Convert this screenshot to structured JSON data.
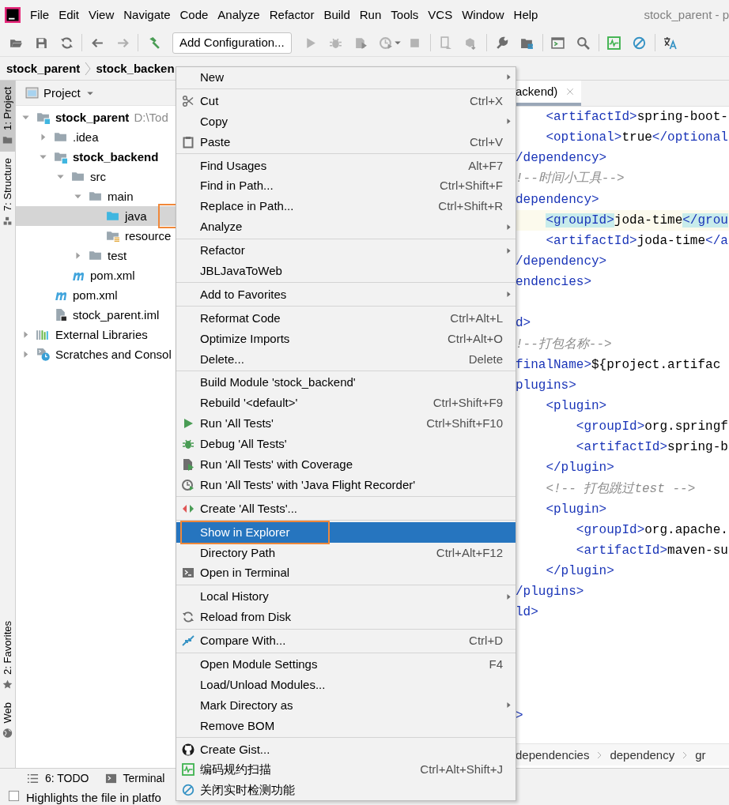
{
  "window": {
    "title": "stock_parent - p"
  },
  "menu_bar": [
    "File",
    "Edit",
    "View",
    "Navigate",
    "Code",
    "Analyze",
    "Refactor",
    "Build",
    "Run",
    "Tools",
    "VCS",
    "Window",
    "Help"
  ],
  "toolbar": {
    "run_config": "Add Configuration..."
  },
  "nav_bar": [
    "stock_parent",
    "stock_backen"
  ],
  "side_tabs_top": [
    {
      "label": "1: Project",
      "selected": true
    },
    {
      "label": "7: Structure",
      "selected": false
    }
  ],
  "side_tabs_bottom": [
    {
      "label": "2: Favorites",
      "selected": false
    },
    {
      "label": "Web",
      "selected": false
    }
  ],
  "project": {
    "title": "Project",
    "tree": [
      {
        "label": "stock_parent",
        "hint": "D:\\Tod",
        "kind": "module",
        "expanded": true,
        "selected": false,
        "outlined": false,
        "children": [
          {
            "label": ".idea",
            "kind": "folder",
            "expanded": false,
            "selected": false,
            "outlined": false
          },
          {
            "label": "stock_backend",
            "kind": "module",
            "expanded": true,
            "selected": false,
            "outlined": false,
            "children": [
              {
                "label": "src",
                "kind": "folder",
                "expanded": true,
                "selected": false,
                "outlined": false,
                "children": [
                  {
                    "label": "main",
                    "kind": "folder",
                    "expanded": true,
                    "selected": false,
                    "outlined": false,
                    "children": [
                      {
                        "label": "java",
                        "kind": "source-folder",
                        "selected": true,
                        "outlined": true
                      },
                      {
                        "label": "resource",
                        "kind": "resource-folder",
                        "selected": false,
                        "outlined": false
                      }
                    ]
                  },
                  {
                    "label": "test",
                    "kind": "folder",
                    "expanded": false,
                    "selected": false,
                    "outlined": false
                  }
                ]
              },
              {
                "label": "pom.xml",
                "kind": "maven",
                "selected": false,
                "outlined": false
              }
            ]
          },
          {
            "label": "pom.xml",
            "kind": "maven",
            "selected": false,
            "outlined": false
          },
          {
            "label": "stock_parent.iml",
            "kind": "iml",
            "selected": false,
            "outlined": false
          }
        ]
      },
      {
        "label": "External Libraries",
        "kind": "libraries",
        "expanded": false,
        "selected": false,
        "outlined": false
      },
      {
        "label": "Scratches and Consol",
        "kind": "scratches",
        "expanded": false,
        "selected": false,
        "outlined": false
      }
    ]
  },
  "editor": {
    "tab": "ackend)",
    "lines": [
      {
        "kind": "code",
        "current": false,
        "segs": [
          {
            "text": "    <artifactId>",
            "kind": "tag"
          },
          {
            "text": "spring-boot-",
            "kind": "text"
          }
        ]
      },
      {
        "kind": "code",
        "current": false,
        "segs": [
          {
            "text": "    <optional>",
            "kind": "tag"
          },
          {
            "text": "true",
            "kind": "text"
          },
          {
            "text": "</optional",
            "kind": "tag"
          }
        ]
      },
      {
        "kind": "code",
        "current": false,
        "segs": [
          {
            "text": "/dependency>",
            "kind": "tag"
          }
        ]
      },
      {
        "kind": "code",
        "current": false,
        "segs": [
          {
            "text": "!--时间小工具-->",
            "kind": "comment"
          }
        ]
      },
      {
        "kind": "code",
        "current": false,
        "segs": [
          {
            "text": "dependency>",
            "kind": "tag"
          }
        ]
      },
      {
        "kind": "code",
        "current": true,
        "segs": [
          {
            "text": "    <groupId>",
            "kind": "match"
          },
          {
            "text": "joda-time",
            "kind": "text"
          },
          {
            "text": "</grou",
            "kind": "match"
          }
        ]
      },
      {
        "kind": "code",
        "current": false,
        "segs": [
          {
            "text": "    <artifactId>",
            "kind": "tag"
          },
          {
            "text": "joda-time",
            "kind": "text"
          },
          {
            "text": "</a",
            "kind": "tag"
          }
        ]
      },
      {
        "kind": "code",
        "current": false,
        "segs": [
          {
            "text": "/dependency>",
            "kind": "tag"
          }
        ]
      },
      {
        "kind": "code",
        "current": false,
        "segs": [
          {
            "text": "endencies>",
            "kind": "tag"
          }
        ]
      },
      {
        "kind": "blank"
      },
      {
        "kind": "code",
        "current": false,
        "segs": [
          {
            "text": "d>",
            "kind": "tag"
          }
        ]
      },
      {
        "kind": "code",
        "current": false,
        "segs": [
          {
            "text": "!--打包名称-->",
            "kind": "comment"
          }
        ]
      },
      {
        "kind": "code",
        "current": false,
        "segs": [
          {
            "text": "finalName>",
            "kind": "tag"
          },
          {
            "text": "${project.artifac",
            "kind": "text"
          }
        ]
      },
      {
        "kind": "code",
        "current": false,
        "segs": [
          {
            "text": "plugins>",
            "kind": "tag"
          }
        ]
      },
      {
        "kind": "code",
        "current": false,
        "segs": [
          {
            "text": "    <plugin>",
            "kind": "tag"
          }
        ]
      },
      {
        "kind": "code",
        "current": false,
        "segs": [
          {
            "text": "        <groupId>",
            "kind": "tag"
          },
          {
            "text": "org.springf",
            "kind": "text"
          }
        ]
      },
      {
        "kind": "code",
        "current": false,
        "segs": [
          {
            "text": "        <artifactId>",
            "kind": "tag"
          },
          {
            "text": "spring-b",
            "kind": "text"
          }
        ]
      },
      {
        "kind": "code",
        "current": false,
        "segs": [
          {
            "text": "    </plugin>",
            "kind": "tag"
          }
        ]
      },
      {
        "kind": "code",
        "current": false,
        "segs": [
          {
            "text": "    <!-- 打包跳过test -->",
            "kind": "comment"
          }
        ]
      },
      {
        "kind": "code",
        "current": false,
        "segs": [
          {
            "text": "    <plugin>",
            "kind": "tag"
          }
        ]
      },
      {
        "kind": "code",
        "current": false,
        "segs": [
          {
            "text": "        <groupId>",
            "kind": "tag"
          },
          {
            "text": "org.apache.",
            "kind": "text"
          }
        ]
      },
      {
        "kind": "code",
        "current": false,
        "segs": [
          {
            "text": "        <artifactId>",
            "kind": "tag"
          },
          {
            "text": "maven-su",
            "kind": "text"
          }
        ]
      },
      {
        "kind": "code",
        "current": false,
        "segs": [
          {
            "text": "    </plugin>",
            "kind": "tag"
          }
        ]
      },
      {
        "kind": "code",
        "current": false,
        "segs": [
          {
            "text": "/plugins>",
            "kind": "tag"
          }
        ]
      },
      {
        "kind": "code",
        "current": false,
        "segs": [
          {
            "text": "ld>",
            "kind": "tag"
          }
        ]
      },
      {
        "kind": "blank"
      },
      {
        "kind": "blank"
      },
      {
        "kind": "blank"
      },
      {
        "kind": "blank"
      },
      {
        "kind": "code",
        "current": false,
        "segs": [
          {
            "text": ">",
            "kind": "tag"
          }
        ]
      }
    ],
    "breadcrumb": [
      "dependencies",
      "dependency",
      "gr"
    ]
  },
  "tool_tabs": [
    "6: TODO",
    "Terminal"
  ],
  "status_bar": "Highlights the file in platfo",
  "context_menu": {
    "groups": [
      [
        {
          "label": "New",
          "kind": "plain",
          "submenu": true,
          "selected": false,
          "outlined": false
        }
      ],
      [
        {
          "label": "Cut",
          "shortcut": "Ctrl+X",
          "kind": "cut",
          "submenu": false,
          "selected": false,
          "outlined": false
        },
        {
          "label": "Copy",
          "kind": "plain",
          "submenu": true,
          "selected": false,
          "outlined": false
        },
        {
          "label": "Paste",
          "shortcut": "Ctrl+V",
          "kind": "paste",
          "submenu": false,
          "selected": false,
          "outlined": false
        }
      ],
      [
        {
          "label": "Find Usages",
          "shortcut": "Alt+F7",
          "kind": "plain",
          "submenu": false,
          "selected": false,
          "outlined": false
        },
        {
          "label": "Find in Path...",
          "shortcut": "Ctrl+Shift+F",
          "kind": "plain",
          "submenu": false,
          "selected": false,
          "outlined": false
        },
        {
          "label": "Replace in Path...",
          "shortcut": "Ctrl+Shift+R",
          "kind": "plain",
          "submenu": false,
          "selected": false,
          "outlined": false
        },
        {
          "label": "Analyze",
          "kind": "plain",
          "submenu": true,
          "selected": false,
          "outlined": false
        }
      ],
      [
        {
          "label": "Refactor",
          "kind": "plain",
          "submenu": true,
          "selected": false,
          "outlined": false
        },
        {
          "label": "JBLJavaToWeb",
          "kind": "plain",
          "submenu": false,
          "selected": false,
          "outlined": false
        }
      ],
      [
        {
          "label": "Add to Favorites",
          "kind": "plain",
          "submenu": true,
          "selected": false,
          "outlined": false
        }
      ],
      [
        {
          "label": "Reformat Code",
          "shortcut": "Ctrl+Alt+L",
          "kind": "plain",
          "submenu": false,
          "selected": false,
          "outlined": false
        },
        {
          "label": "Optimize Imports",
          "shortcut": "Ctrl+Alt+O",
          "kind": "plain",
          "submenu": false,
          "selected": false,
          "outlined": false
        },
        {
          "label": "Delete...",
          "shortcut": "Delete",
          "kind": "plain",
          "submenu": false,
          "selected": false,
          "outlined": false
        }
      ],
      [
        {
          "label": "Build Module 'stock_backend'",
          "kind": "plain",
          "submenu": false,
          "selected": false,
          "outlined": false
        },
        {
          "label": "Rebuild '<default>'",
          "shortcut": "Ctrl+Shift+F9",
          "kind": "plain",
          "submenu": false,
          "selected": false,
          "outlined": false
        },
        {
          "label": "Run 'All Tests'",
          "shortcut": "Ctrl+Shift+F10",
          "kind": "run",
          "submenu": false,
          "selected": false,
          "outlined": false
        },
        {
          "label": "Debug 'All Tests'",
          "kind": "debug",
          "submenu": false,
          "selected": false,
          "outlined": false
        },
        {
          "label": "Run 'All Tests' with Coverage",
          "kind": "coverage",
          "submenu": false,
          "selected": false,
          "outlined": false
        },
        {
          "label": "Run 'All Tests' with 'Java Flight Recorder'",
          "kind": "profiler",
          "submenu": false,
          "selected": false,
          "outlined": false
        }
      ],
      [
        {
          "label": "Create 'All Tests'...",
          "kind": "create-test",
          "submenu": false,
          "selected": false,
          "outlined": false
        }
      ],
      [
        {
          "label": "Show in Explorer",
          "kind": "plain",
          "submenu": false,
          "selected": true,
          "outlined": true
        },
        {
          "label": "Directory Path",
          "shortcut": "Ctrl+Alt+F12",
          "kind": "plain",
          "submenu": false,
          "selected": false,
          "outlined": false
        },
        {
          "label": "Open in Terminal",
          "kind": "terminal",
          "submenu": false,
          "selected": false,
          "outlined": false
        }
      ],
      [
        {
          "label": "Local History",
          "kind": "plain",
          "submenu": true,
          "selected": false,
          "outlined": false
        },
        {
          "label": "Reload from Disk",
          "kind": "reload",
          "submenu": false,
          "selected": false,
          "outlined": false
        }
      ],
      [
        {
          "label": "Compare With...",
          "shortcut": "Ctrl+D",
          "kind": "compare",
          "submenu": false,
          "selected": false,
          "outlined": false
        }
      ],
      [
        {
          "label": "Open Module Settings",
          "shortcut": "F4",
          "kind": "plain",
          "submenu": false,
          "selected": false,
          "outlined": false
        },
        {
          "label": "Load/Unload Modules...",
          "kind": "plain",
          "submenu": false,
          "selected": false,
          "outlined": false
        },
        {
          "label": "Mark Directory as",
          "kind": "plain",
          "submenu": true,
          "selected": false,
          "outlined": false
        },
        {
          "label": "Remove BOM",
          "kind": "plain",
          "submenu": false,
          "selected": false,
          "outlined": false
        }
      ],
      [
        {
          "label": "Create Gist...",
          "kind": "github",
          "submenu": false,
          "selected": false,
          "outlined": false
        },
        {
          "label": "编码规约扫描",
          "shortcut": "Ctrl+Alt+Shift+J",
          "kind": "scan",
          "submenu": false,
          "selected": false,
          "outlined": false
        },
        {
          "label": "关闭实时检测功能",
          "kind": "disable",
          "submenu": false,
          "selected": false,
          "outlined": false
        }
      ]
    ]
  }
}
